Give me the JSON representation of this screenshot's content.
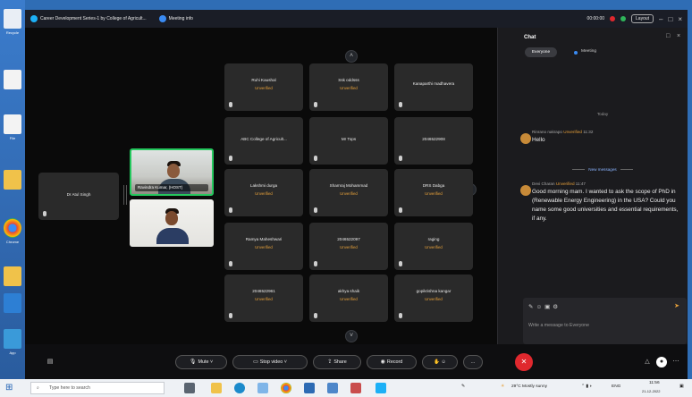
{
  "window": {
    "title": "Career Development Series-1 by College of Agricult...",
    "info_tab": "Meeting info",
    "timer": "00:00:00",
    "layout_label": "Layout"
  },
  "stage": {
    "featured_name": "Dr Atul Singh",
    "videos": [
      {
        "caption": "Ravindra Kumar, (HOST)"
      },
      {
        "caption": ""
      }
    ],
    "tiles": [
      {
        "name": "Ruhi Kaushal",
        "status": "Unverified"
      },
      {
        "name": "Ssk oddsss",
        "status": "Unverified"
      },
      {
        "name": "Kanaparthi madhavera",
        "status": ""
      },
      {
        "name": "ABC College of Agricult...",
        "status": ""
      },
      {
        "name": "Mr Tops",
        "status": ""
      },
      {
        "name": "2046522908",
        "status": ""
      },
      {
        "name": "Lakshmi durga",
        "status": "Unverified"
      },
      {
        "name": "Shamraj Mohammad",
        "status": "Unverified"
      },
      {
        "name": "DRS Dabga",
        "status": "Unverified"
      },
      {
        "name": "Ramya Maheshwari",
        "status": "Unverified"
      },
      {
        "name": "2046522097",
        "status": "Unverified"
      },
      {
        "name": "raging",
        "status": "Unverified"
      },
      {
        "name": "2046522961",
        "status": "Unverified"
      },
      {
        "name": "akhya shaik",
        "status": "Unverified"
      },
      {
        "name": "gopikrishna kangar",
        "status": "Unverified"
      }
    ]
  },
  "chat": {
    "title": "Chat",
    "everyone_label": "Everyone",
    "meeting_label": "Meeting",
    "today_label": "Today",
    "messages": [
      {
        "sender": "Rinrano nakrapo",
        "status": "Unverified",
        "time": "11:32",
        "text": "Hello"
      },
      {
        "sender": "Devi Charan",
        "status": "Unverified",
        "time": "11:47",
        "text": "Good morning mam. I wanted to ask the scope of PhD in (Renewable Energy Engineering) in the USA? Could you name some good universities and essential requirements, if any."
      }
    ],
    "new_messages_label": "New messages",
    "input_placeholder": "Write a message to Everyone"
  },
  "controls": {
    "mute": "Mute",
    "stop_video": "Stop video",
    "share": "Share",
    "record": "Record"
  },
  "taskbar": {
    "search_placeholder": "Type here to search",
    "weather": "29°C Mostly sunny",
    "language": "ENG",
    "time": "11:56",
    "date": "21-12-2022"
  },
  "desktop_icons": [
    "Recycle",
    "File",
    "Chrome",
    "Folder",
    "App"
  ]
}
